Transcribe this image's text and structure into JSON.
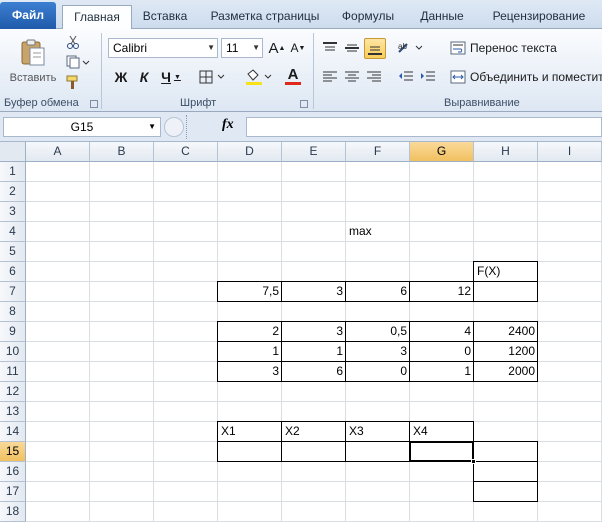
{
  "ribbon": {
    "tabs": [
      "Файл",
      "Главная",
      "Вставка",
      "Разметка страницы",
      "Формулы",
      "Данные",
      "Рецензирование"
    ],
    "clipboard": {
      "paste_label": "Вставить",
      "group_label": "Буфер обмена"
    },
    "font": {
      "name": "Calibri",
      "size": "11",
      "bold": "Ж",
      "italic": "К",
      "underline": "Ч",
      "group_label": "Шрифт",
      "grow": "A",
      "shrink": "A",
      "color_letter": "A",
      "font_color": "#e0281c",
      "fill_color": "#f7e11a"
    },
    "alignment": {
      "wrap_text": "Перенос текста",
      "merge": "Объединить и поместить",
      "group_label": "Выравнивание"
    }
  },
  "formula_bar": {
    "cell_ref": "G15",
    "fx": "fx",
    "formula": ""
  },
  "sheet": {
    "columns": [
      "A",
      "B",
      "C",
      "D",
      "E",
      "F",
      "G",
      "H",
      "I"
    ],
    "rows": [
      "1",
      "2",
      "3",
      "4",
      "5",
      "6",
      "7",
      "8",
      "9",
      "10",
      "11",
      "12",
      "13",
      "14",
      "15",
      "16",
      "17",
      "18"
    ],
    "active_cell": "G15",
    "cells": {
      "F4": "max",
      "H6": "F(X)",
      "D7": "7,5",
      "E7": "3",
      "F7": "6",
      "G7": "12",
      "D9": "2",
      "E9": "3",
      "F9": "0,5",
      "G9": "4",
      "H9": "2400",
      "D10": "1",
      "E10": "1",
      "F10": "3",
      "G10": "0",
      "H10": "1200",
      "D11": "3",
      "E11": "6",
      "F11": "0",
      "G11": "1",
      "H11": "2000",
      "D14": "X1",
      "E14": "X2",
      "F14": "X3",
      "G14": "X4"
    }
  },
  "colors": {
    "file_tab": "#2a6bc2",
    "selection_header": "#f5c96b",
    "gridline": "#d9dee6"
  }
}
